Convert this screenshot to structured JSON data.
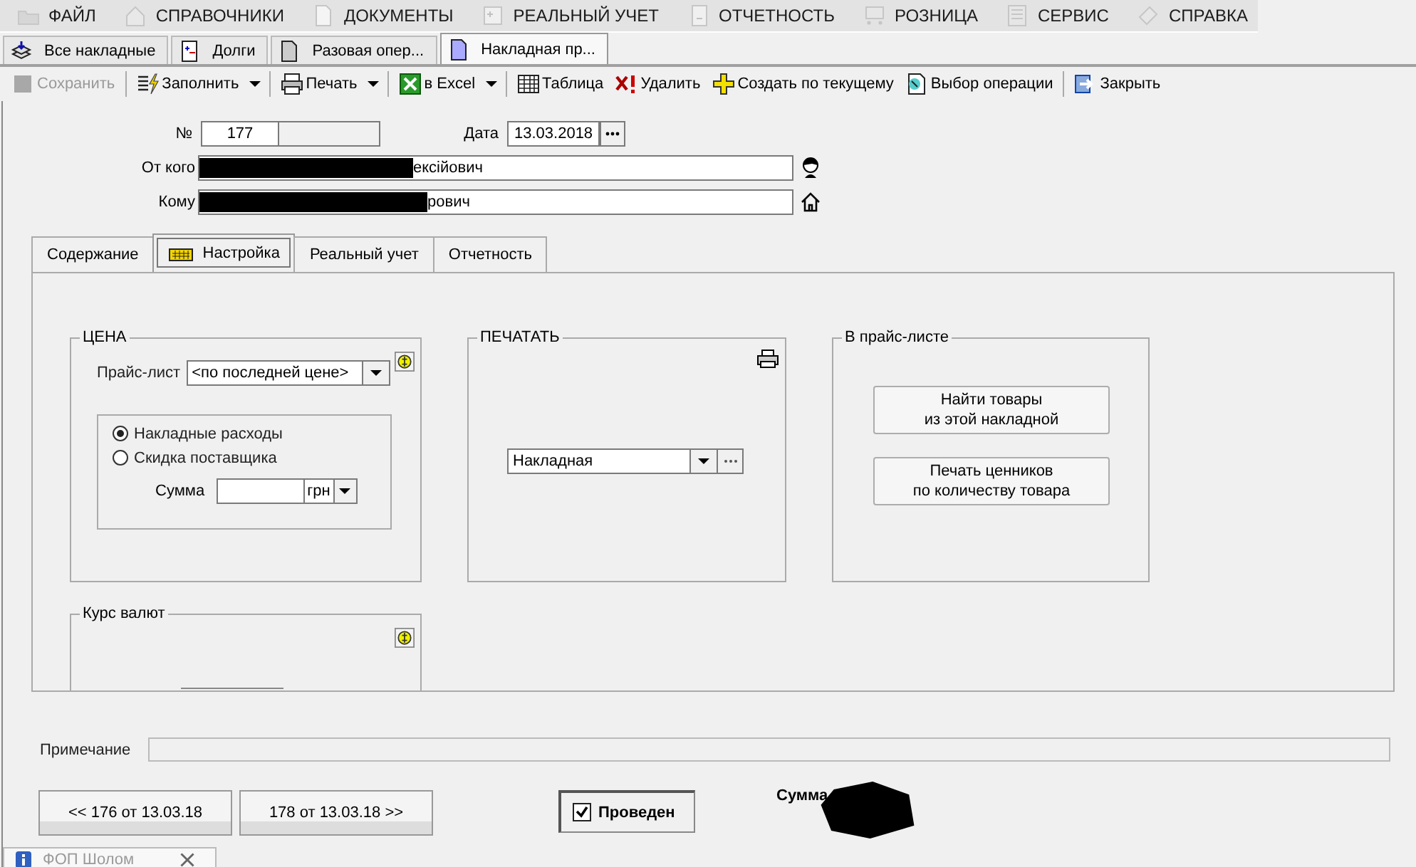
{
  "menu": [
    {
      "label": "ФАЙЛ"
    },
    {
      "label": "СПРАВОЧНИКИ"
    },
    {
      "label": "ДОКУМЕНТЫ"
    },
    {
      "label": "РЕАЛЬНЫЙ УЧЕТ"
    },
    {
      "label": "ОТЧЕТНОСТЬ"
    },
    {
      "label": "РОЗНИЦА"
    },
    {
      "label": "СЕРВИС"
    },
    {
      "label": "СПРАВКА"
    }
  ],
  "doc_tabs": [
    {
      "label": "Все накладные",
      "selected": false
    },
    {
      "label": "Долги",
      "selected": false
    },
    {
      "label": "Разовая опер...",
      "selected": false
    },
    {
      "label": "Накладная пр...",
      "selected": true
    }
  ],
  "toolbar": [
    {
      "label": "Сохранить",
      "kind": "button",
      "disabled": true
    },
    {
      "label": "Заполнить",
      "kind": "split",
      "disabled": false
    },
    {
      "label": "Печать",
      "kind": "split",
      "disabled": false
    },
    {
      "label": "в Excel",
      "kind": "split",
      "disabled": false
    },
    {
      "label": "Таблица",
      "kind": "button",
      "disabled": false
    },
    {
      "label": "Удалить",
      "kind": "button",
      "disabled": false
    },
    {
      "label": "Создать по текущему",
      "kind": "button",
      "disabled": false
    },
    {
      "label": "Выбор операции",
      "kind": "button",
      "disabled": false
    },
    {
      "label": "Закрыть",
      "kind": "button",
      "disabled": false
    }
  ],
  "header": {
    "number_label": "№",
    "number": "177",
    "date_label": "Дата",
    "date": "13.03.2018",
    "from_label": "От кого",
    "from_value": "ексійович",
    "to_label": "Кому",
    "to_value": "рович"
  },
  "tabs": [
    {
      "label": "Содержание",
      "selected": false
    },
    {
      "label": "Настройка",
      "selected": true
    },
    {
      "label": "Реальный учет",
      "selected": false
    },
    {
      "label": "Отчетность",
      "selected": false
    }
  ],
  "price": {
    "title": "ЦЕНА",
    "price_list_label": "Прайс-лист",
    "price_list_value": "<по последней цене>",
    "options": [
      {
        "label": "Накладные расходы",
        "selected": true
      },
      {
        "label": "Скидка поставщика",
        "selected": false
      }
    ],
    "sum_label": "Сумма",
    "currency": "грн"
  },
  "print": {
    "title": "ПЕЧАТАТЬ",
    "value": "Накладная"
  },
  "price_list": {
    "title": "В прайс-листе",
    "buttons": [
      {
        "lines": [
          "Найти товары",
          "из этой накладной"
        ]
      },
      {
        "lines": [
          "Печать ценников",
          "по количеству товара"
        ]
      }
    ]
  },
  "rates": {
    "title": "Курс валют"
  },
  "note_label": "Примечание",
  "nav_buttons": [
    "<< 176 от 13.03.18",
    "178 от 13.03.18 >>"
  ],
  "posted": {
    "label": "Проведен",
    "checked": true
  },
  "total_label": "Сумма",
  "taskbar_tab": "ФОП Шолом"
}
